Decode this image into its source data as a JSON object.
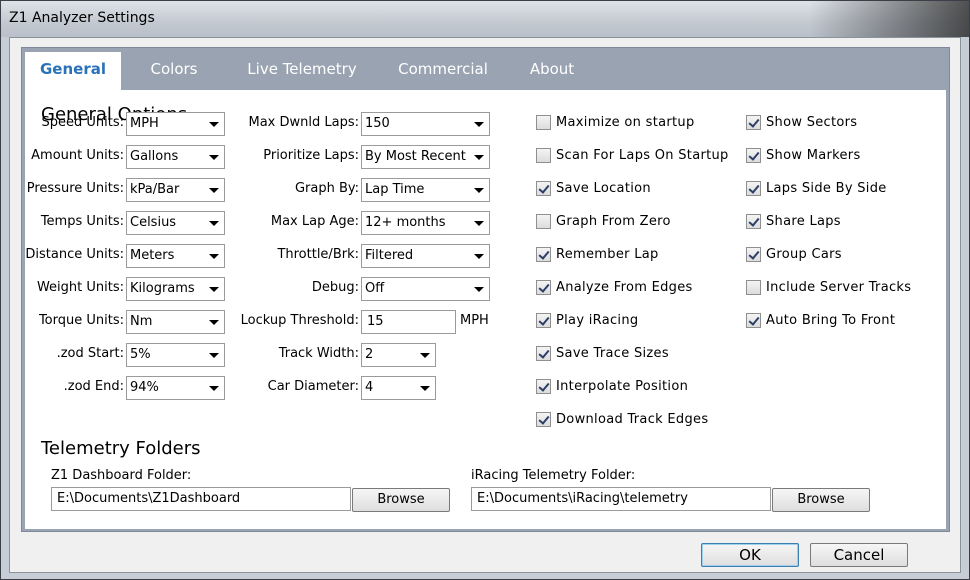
{
  "window": {
    "title": "Z1 Analyzer Settings"
  },
  "tabs": [
    "General",
    "Colors",
    "Live Telemetry",
    "Commercial",
    "About"
  ],
  "general": {
    "heading": "General Options",
    "left": [
      {
        "label": "Speed Units:",
        "value": "MPH"
      },
      {
        "label": "Amount Units:",
        "value": "Gallons"
      },
      {
        "label": "Pressure Units:",
        "value": "kPa/Bar"
      },
      {
        "label": "Temps Units:",
        "value": "Celsius"
      },
      {
        "label": "Distance Units:",
        "value": "Meters"
      },
      {
        "label": "Weight Units:",
        "value": "Kilograms"
      },
      {
        "label": "Torque Units:",
        "value": "Nm"
      },
      {
        "label": ".zod Start:",
        "value": "5%"
      },
      {
        "label": ".zod End:",
        "value": "94%"
      }
    ],
    "middle": [
      {
        "label": "Max Dwnld Laps:",
        "value": "150"
      },
      {
        "label": "Prioritize Laps:",
        "value": "By Most Recent"
      },
      {
        "label": "Graph By:",
        "value": "Lap Time"
      },
      {
        "label": "Max Lap Age:",
        "value": "12+ months"
      },
      {
        "label": "Throttle/Brk:",
        "value": "Filtered"
      },
      {
        "label": "Debug:",
        "value": "Off"
      },
      {
        "label": "Lockup Threshold:",
        "value": "15",
        "unit": "MPH"
      },
      {
        "label": "Track Width:",
        "value": "2"
      },
      {
        "label": "Car Diameter:",
        "value": "4"
      }
    ],
    "checks1": [
      {
        "label": "Maximize on startup",
        "checked": false
      },
      {
        "label": "Scan For Laps On Startup",
        "checked": false
      },
      {
        "label": "Save Location",
        "checked": true
      },
      {
        "label": "Graph From Zero",
        "checked": false
      },
      {
        "label": "Remember Lap",
        "checked": true
      },
      {
        "label": "Analyze From Edges",
        "checked": true
      },
      {
        "label": "Play iRacing",
        "checked": true
      },
      {
        "label": "Save Trace Sizes",
        "checked": true
      },
      {
        "label": "Interpolate Position",
        "checked": true
      },
      {
        "label": "Download Track Edges",
        "checked": true
      }
    ],
    "checks2": [
      {
        "label": "Show Sectors",
        "checked": true
      },
      {
        "label": "Show Markers",
        "checked": true
      },
      {
        "label": "Laps Side By Side",
        "checked": true
      },
      {
        "label": "Share Laps",
        "checked": true
      },
      {
        "label": "Group Cars",
        "checked": true
      },
      {
        "label": "Include Server Tracks",
        "checked": false
      },
      {
        "label": "Auto Bring To Front",
        "checked": true
      }
    ]
  },
  "telemetry": {
    "heading": "Telemetry Folders",
    "z1_label": "Z1 Dashboard Folder:",
    "z1_path": "E:\\Documents\\Z1Dashboard",
    "iracing_label": "iRacing Telemetry Folder:",
    "iracing_path": "E:\\Documents\\iRacing\\telemetry",
    "browse": "Browse"
  },
  "buttons": {
    "ok": "OK",
    "cancel": "Cancel"
  }
}
